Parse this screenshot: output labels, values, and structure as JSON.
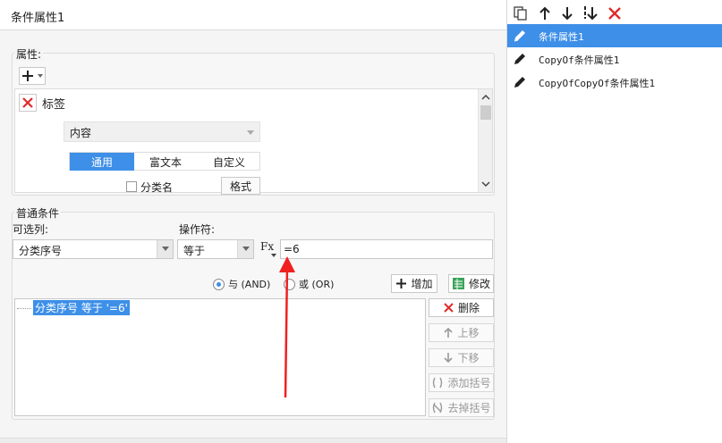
{
  "dialog": {
    "title": "条件属性1"
  },
  "attributes": {
    "group_label": "属性:",
    "add_icon": "plus-dropdown-icon",
    "item_label": "标签",
    "content_value": "内容",
    "tabs": [
      "通用",
      "富文本",
      "自定义"
    ],
    "checkbox_label": "分类名",
    "format_button": "格式"
  },
  "condition": {
    "group_label": "普通条件",
    "column_label": "可选列:",
    "operator_label": "操作符:",
    "column_value": "分类序号",
    "operator_value": "等于",
    "formula_icon": "Fx",
    "value_input": "=6",
    "and_label": "与 (AND)",
    "or_label": "或 (OR)",
    "add_button": "增加",
    "modify_button": "修改",
    "condition_item": "分类序号 等于 '=6'",
    "side_buttons": [
      "删除",
      "上移",
      "下移",
      "添加括号",
      "去掉括号"
    ]
  },
  "right_panel": {
    "items": [
      "条件属性1",
      "CopyOf条件属性1",
      "CopyOfCopyOf条件属性1"
    ]
  },
  "colors": {
    "selection": "#3d8fe8",
    "tab_active": "#3d8fe8",
    "arrow": "#f02020",
    "delete": "#e02b2b"
  }
}
